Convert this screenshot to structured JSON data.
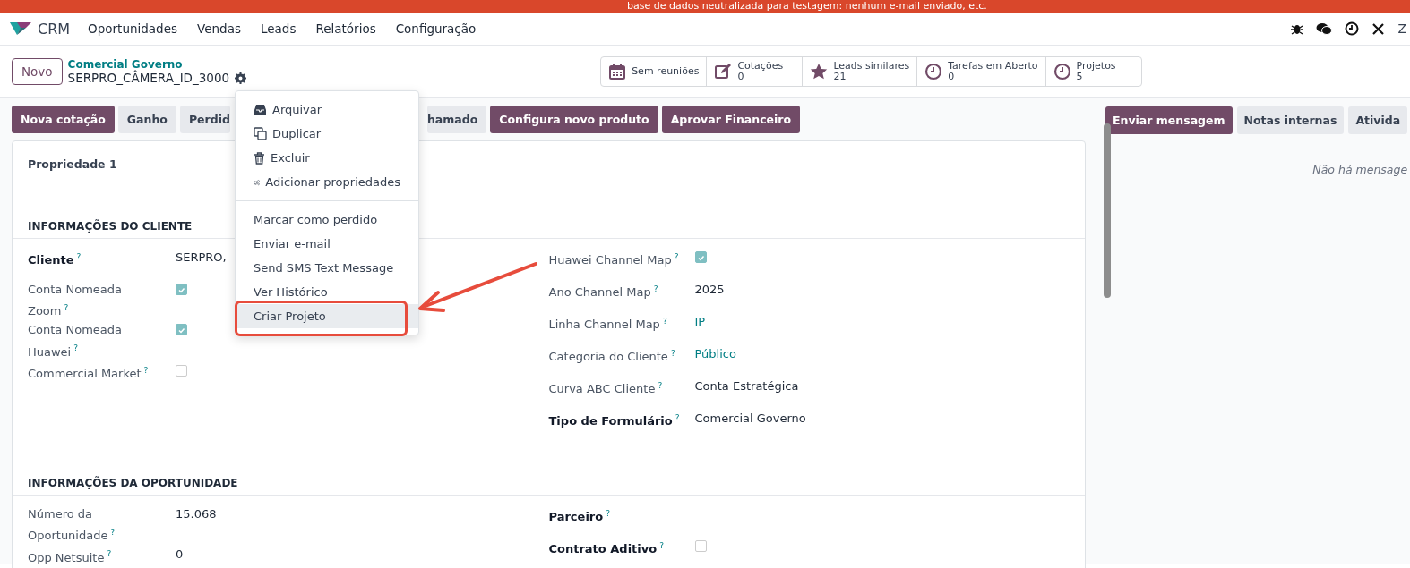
{
  "banner": {
    "text": "base de dados neutralizada para testagem: nenhum e-mail enviado, etc."
  },
  "navbar": {
    "app": "CRM",
    "menu": [
      "Oportunidades",
      "Vendas",
      "Leads",
      "Relatórios",
      "Configuração"
    ],
    "avatar": "Z"
  },
  "control_panel": {
    "new_button": "Novo",
    "breadcrumb": "Comercial Governo",
    "record": "SERPRO_CÂMERA_ID_3000",
    "stats": [
      {
        "label": "Sem reuniões"
      },
      {
        "label": "Cotações",
        "count": "0"
      },
      {
        "label": "Leads similares",
        "count": "21"
      },
      {
        "label": "Tarefas em Aberto",
        "count": "0"
      },
      {
        "label": "Projetos",
        "count": "5"
      }
    ]
  },
  "actions": [
    {
      "label": "Nova cotação",
      "kind": "primary"
    },
    {
      "label": "Ganho",
      "kind": "secondary"
    },
    {
      "label": "Perdid",
      "kind": "secondary"
    },
    {
      "label": "hamado",
      "kind": "secondary"
    },
    {
      "label": "Configura novo produto",
      "kind": "primary"
    },
    {
      "label": "Aprovar Financeiro",
      "kind": "primary"
    }
  ],
  "gear_menu": {
    "items": [
      {
        "label": "Arquivar",
        "selected": false
      },
      {
        "label": "Duplicar",
        "selected": false
      },
      {
        "label": "Excluir",
        "selected": false
      },
      {
        "label": "Adicionar propriedades",
        "selected": false
      },
      {
        "label": "Marcar como perdido",
        "selected": false
      },
      {
        "label": "Enviar e-mail",
        "selected": false
      },
      {
        "label": "Send SMS Text Message",
        "selected": false
      },
      {
        "label": "Ver Histórico",
        "selected": false
      },
      {
        "label": "Criar Projeto",
        "selected": true
      }
    ]
  },
  "form": {
    "property": "Propriedade 1",
    "sections": [
      {
        "title": "INFORMAÇÕES DO CLIENTE",
        "left": [
          {
            "label": "Cliente",
            "help": "?",
            "required": true,
            "kind": "text",
            "value": "SERPRO,"
          },
          {
            "label": "Conta Nomeada Zoom",
            "help": "?",
            "required": false,
            "kind": "checkbox",
            "checked": true
          },
          {
            "label": "Conta Nomeada Huawei",
            "help": "?",
            "required": false,
            "kind": "checkbox",
            "checked": true
          },
          {
            "label": "Commercial Market",
            "help": "?",
            "required": false,
            "kind": "checkbox",
            "checked": false
          }
        ],
        "right": [
          {
            "label": "Huawei Channel Map",
            "help": "?",
            "required": false,
            "kind": "checkbox",
            "checked": true
          },
          {
            "label": "Ano Channel Map",
            "help": "?",
            "required": false,
            "kind": "text",
            "value": "2025"
          },
          {
            "label": "Linha Channel Map",
            "help": "?",
            "required": false,
            "kind": "link",
            "value": "IP"
          },
          {
            "label": "Categoria do Cliente",
            "help": "?",
            "required": false,
            "kind": "link",
            "value": "Público"
          },
          {
            "label": "Curva ABC Cliente",
            "help": "?",
            "required": false,
            "kind": "text",
            "value": "Conta Estratégica"
          },
          {
            "label": "Tipo de Formulário",
            "help": "?",
            "required": true,
            "kind": "text",
            "value": "Comercial Governo"
          }
        ]
      },
      {
        "title": "INFORMAÇÕES DA OPORTUNIDADE",
        "left": [
          {
            "label": "Número da Oportunidade",
            "help": "?",
            "required": false,
            "kind": "text",
            "value": "15.068"
          },
          {
            "label": "Opp Netsuite",
            "help": "?",
            "required": false,
            "kind": "text",
            "value": "0"
          }
        ],
        "right": [
          {
            "label": "Parceiro",
            "help": "?",
            "required": true,
            "kind": "empty"
          },
          {
            "label": "Contrato Aditivo",
            "help": "?",
            "required": true,
            "kind": "checkbox",
            "checked": false
          }
        ]
      }
    ]
  },
  "chatter": {
    "buttons": [
      {
        "label": "Enviar mensagem",
        "selected": true
      },
      {
        "label": "Notas internas",
        "selected": false
      },
      {
        "label": "Ativida",
        "selected": false
      }
    ],
    "empty": "Não há mensage"
  }
}
